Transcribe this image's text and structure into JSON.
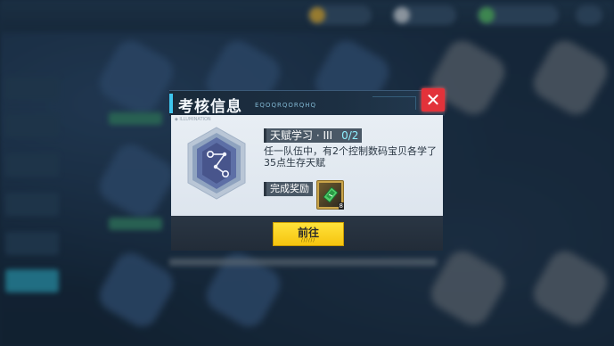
{
  "dialog": {
    "title": "考核信息",
    "title_deco": "EQOQRQORQHQ",
    "close_label": "✕",
    "panel_tiny": "◆ ILLUMINATION",
    "task": {
      "label": "天赋学习 · III",
      "progress": "0/2",
      "description": "任一队伍中，有2个控制数码宝贝各学了35点生存天赋"
    },
    "reward": {
      "label": "完成奖励",
      "item_count": "8"
    },
    "go_button": {
      "label": "前往",
      "sub": "//////"
    }
  },
  "colors": {
    "accent": "#3fc5ee",
    "close": "#e2323a",
    "go_button": "#f6c40f",
    "progress": "#8ff0ff"
  },
  "icons": {
    "badge": "constellation-hex-badge-icon",
    "close": "close-icon",
    "reward": "ticket-icon"
  }
}
